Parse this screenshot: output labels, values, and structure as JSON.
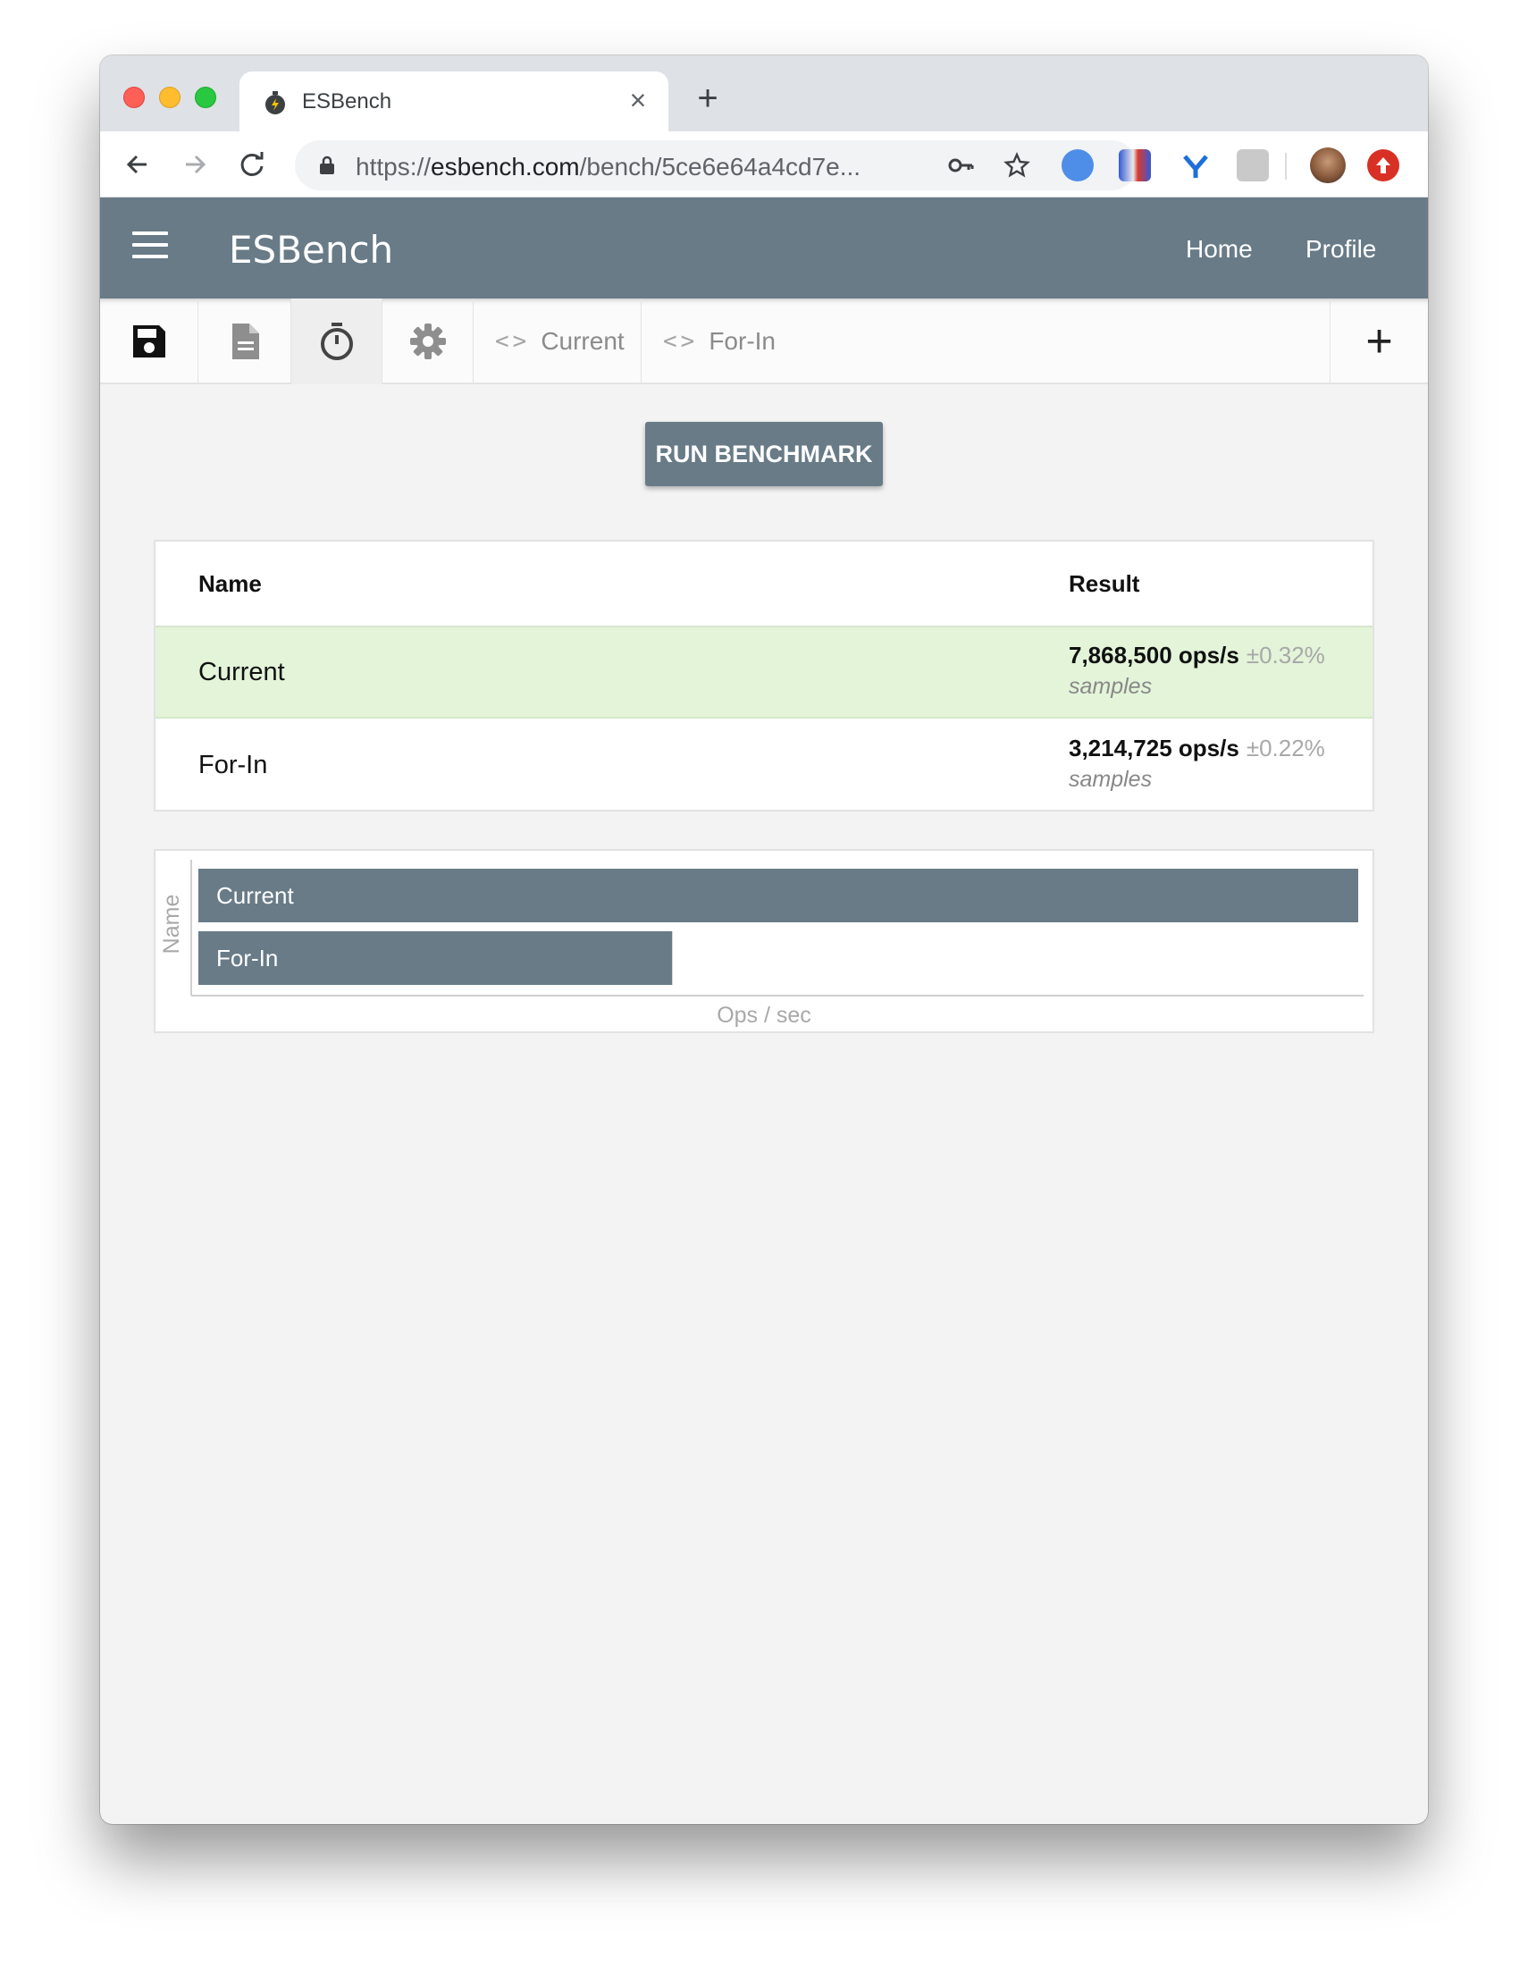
{
  "browser": {
    "tab_title": "ESBench",
    "tab_close": "×",
    "new_tab": "+",
    "url_scheme": "https://",
    "url_host": "esbench.com",
    "url_path": "/bench/5ce6e64a4cd7e..."
  },
  "app": {
    "brand": "ESBench",
    "nav": {
      "home": "Home",
      "profile": "Profile"
    }
  },
  "editor": {
    "tabs": [
      {
        "label": "Current",
        "code_glyph": "<>"
      },
      {
        "label": "For-In",
        "code_glyph": "<>"
      }
    ],
    "add_label": "+",
    "icons": [
      "save-icon",
      "document-icon",
      "stopwatch-icon",
      "gear-icon"
    ]
  },
  "run_button": "RUN BENCHMARK",
  "results": {
    "headers": {
      "name": "Name",
      "result": "Result"
    },
    "rows": [
      {
        "name": "Current",
        "ops": "7,868,500 ops/s",
        "error": "±0.32%",
        "samples": "samples",
        "winner": true
      },
      {
        "name": "For-In",
        "ops": "3,214,725 ops/s",
        "error": "±0.22%",
        "samples": "samples",
        "winner": false
      }
    ]
  },
  "colors": {
    "accent": "#687b87",
    "winner_row": "#e3f4d9",
    "bar": "#687b87"
  },
  "chart_data": {
    "type": "bar",
    "orientation": "horizontal",
    "categories": [
      "Current",
      "For-In"
    ],
    "values": [
      7868500,
      3214725
    ],
    "xlabel": "Ops / sec",
    "ylabel": "Name",
    "xlim": [
      0,
      7868500
    ],
    "grid": false,
    "legend": "none"
  }
}
